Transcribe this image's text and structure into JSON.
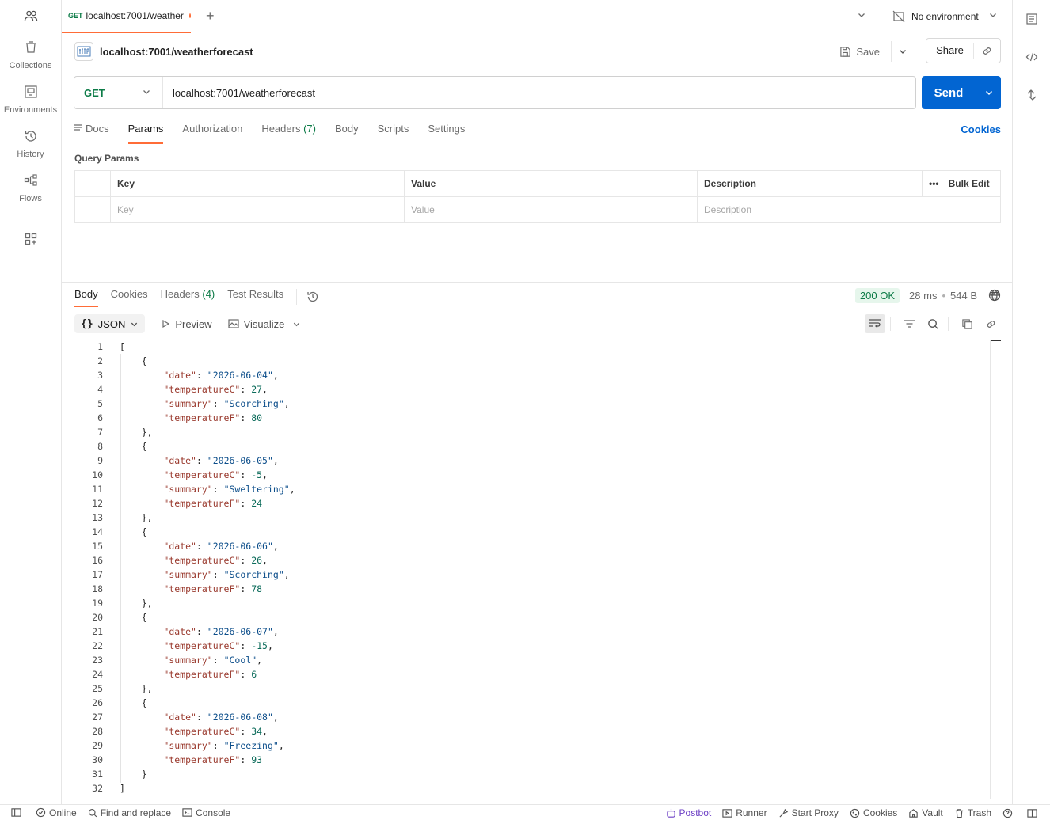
{
  "sidebar": {
    "items": [
      {
        "label": "Collections",
        "icon": "collections-icon"
      },
      {
        "label": "Environments",
        "icon": "environments-icon"
      },
      {
        "label": "History",
        "icon": "history-icon"
      },
      {
        "label": "Flows",
        "icon": "flows-icon"
      }
    ]
  },
  "tabs": [
    {
      "method": "GET",
      "title": "localhost:7001/weather",
      "unsaved": true
    }
  ],
  "environment": {
    "label": "No environment"
  },
  "request": {
    "name": "localhost:7001/weatherforecast",
    "method": "GET",
    "url": "localhost:7001/weatherforecast",
    "save_label": "Save",
    "share_label": "Share",
    "send_label": "Send",
    "tabs": [
      {
        "label": "Docs",
        "count": ""
      },
      {
        "label": "Params",
        "count": ""
      },
      {
        "label": "Authorization",
        "count": ""
      },
      {
        "label": "Headers",
        "count": "(7)"
      },
      {
        "label": "Body",
        "count": ""
      },
      {
        "label": "Scripts",
        "count": ""
      },
      {
        "label": "Settings",
        "count": ""
      }
    ],
    "active_tab": "Params",
    "cookies_label": "Cookies"
  },
  "query_params": {
    "title": "Query Params",
    "headers": {
      "key": "Key",
      "value": "Value",
      "description": "Description",
      "bulk_edit": "Bulk Edit"
    },
    "placeholders": {
      "key": "Key",
      "value": "Value",
      "description": "Description"
    }
  },
  "response": {
    "tabs": [
      {
        "label": "Body",
        "count": ""
      },
      {
        "label": "Cookies",
        "count": ""
      },
      {
        "label": "Headers",
        "count": "(4)"
      },
      {
        "label": "Test Results",
        "count": ""
      }
    ],
    "status": "200 OK",
    "time": "28 ms",
    "size": "544 B",
    "format": "JSON",
    "preview_label": "Preview",
    "visualize_label": "Visualize",
    "body": [
      {
        "date": "2026-06-04",
        "temperatureC": "27",
        "summary": "Scorching",
        "temperatureF": "80"
      },
      {
        "date": "2026-06-05",
        "temperatureC": "-5",
        "summary": "Sweltering",
        "temperatureF": "24"
      },
      {
        "date": "2026-06-06",
        "temperatureC": "26",
        "summary": "Scorching",
        "temperatureF": "78"
      },
      {
        "date": "2026-06-07",
        "temperatureC": "-15",
        "summary": "Cool",
        "temperatureF": "6"
      },
      {
        "date": "2026-06-08",
        "temperatureC": "34",
        "summary": "Freezing",
        "temperatureF": "93"
      }
    ]
  },
  "statusbar": {
    "left": [
      "Online",
      "Find and replace",
      "Console"
    ],
    "right": [
      "Postbot",
      "Runner",
      "Start Proxy",
      "Cookies",
      "Vault",
      "Trash"
    ]
  },
  "colors": {
    "accent": "#ff6c37",
    "send": "#0265d2",
    "get_method": "#0c7b47",
    "status_ok_bg": "#e6f6ec"
  }
}
